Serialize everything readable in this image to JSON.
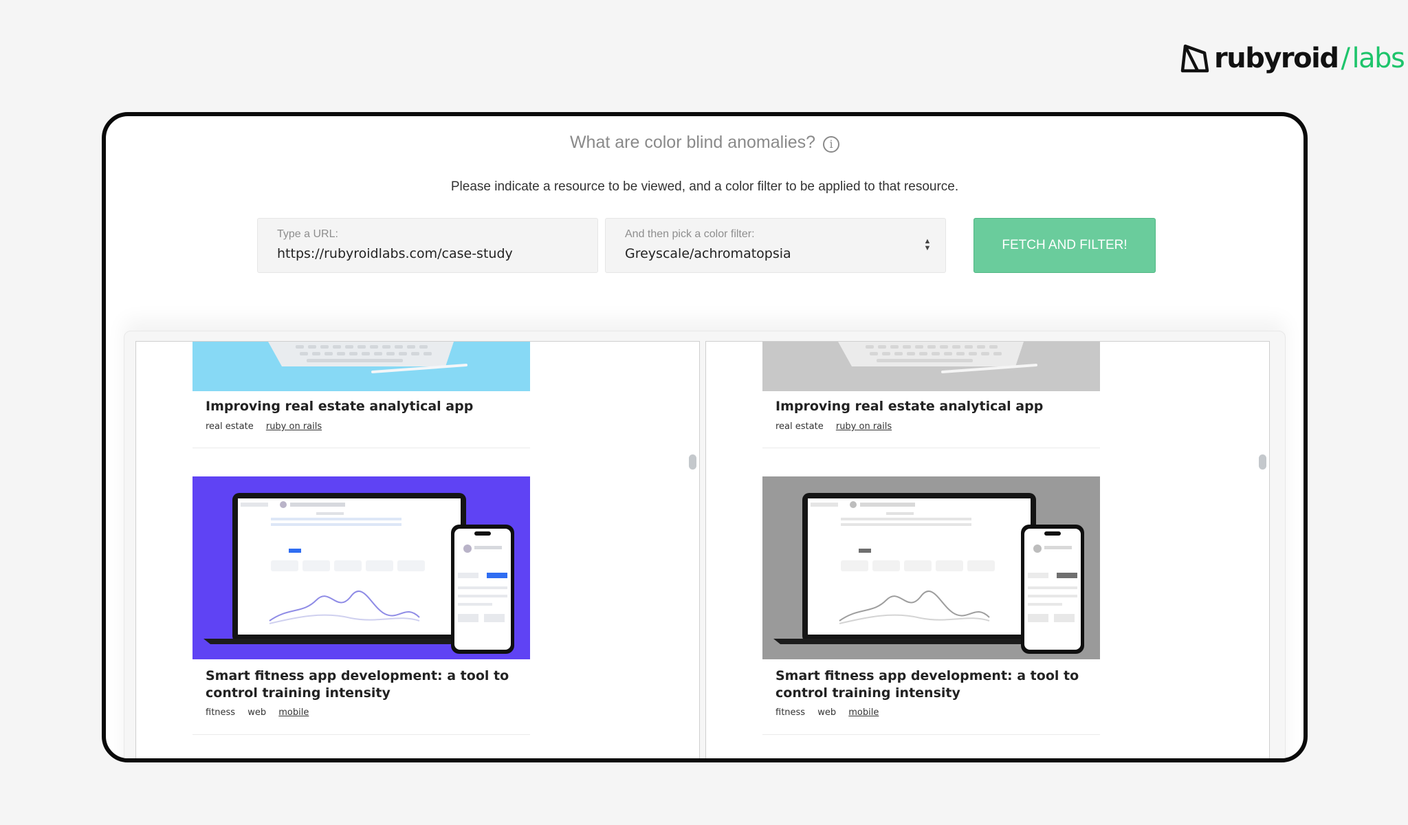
{
  "brand": {
    "logo_word": "rubyroid",
    "logo_slash": "/",
    "logo_suffix": "labs"
  },
  "header": {
    "title": "What are color blind anomalies?",
    "subtitle": "Please indicate a resource to be viewed, and a color filter to be applied to that resource."
  },
  "form": {
    "url_label": "Type a URL:",
    "url_value": "https://rubyroidlabs.com/case-study",
    "filter_label": "And then pick a color filter:",
    "filter_value": "Greyscale/achromatopsia",
    "submit_label": "FETCH AND FILTER!"
  },
  "panes": [
    {
      "name": "original",
      "cards": [
        {
          "title": "Improving real estate analytical app",
          "tags": [
            "real estate",
            "ruby on rails"
          ]
        },
        {
          "title": "Smart fitness app development: a tool to control training intensity",
          "tags": [
            "fitness",
            "web",
            "mobile"
          ]
        }
      ]
    },
    {
      "name": "filtered",
      "cards": [
        {
          "title": "Improving real estate analytical app",
          "tags": [
            "real estate",
            "ruby on rails"
          ]
        },
        {
          "title": "Smart fitness app development: a tool to control training intensity",
          "tags": [
            "fitness",
            "web",
            "mobile"
          ]
        }
      ]
    }
  ],
  "colors": {
    "accent_green": "#6acc9c",
    "logo_green": "#1ec46b",
    "image1_bg_original": "#87d9f5",
    "image2_bg_original": "#5f43f4",
    "image1_bg_filtered": "#c8c8c8",
    "image2_bg_filtered": "#9a9a9a"
  }
}
